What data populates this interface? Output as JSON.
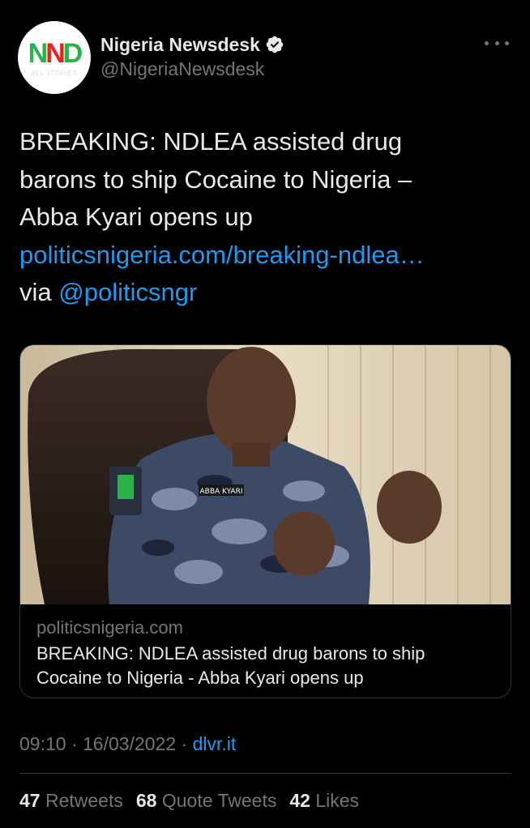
{
  "account": {
    "display_name": "Nigeria Newsdesk",
    "handle": "@NigeriaNewsdesk",
    "avatar_logo": "NND",
    "avatar_sub": "ALL STORIES",
    "verified_icon": "verified-badge-icon"
  },
  "tweet": {
    "line1": "BREAKING: NDLEA assisted drug",
    "line2": "barons to ship Cocaine to Nigeria –",
    "line3": "Abba Kyari opens up",
    "link": "politicsnigeria.com/breaking-ndlea…",
    "via_prefix": "via ",
    "via_handle": "@politicsngr"
  },
  "card": {
    "domain": "politicsnigeria.com",
    "title_line1": "BREAKING: NDLEA assisted drug barons to ship",
    "title_line2": "Cocaine to Nigeria - Abba Kyari opens up",
    "image_badge": "ABBA KYARI"
  },
  "meta": {
    "time": "09:10",
    "sep1": " · ",
    "date": "16/03/2022",
    "sep2": " · ",
    "source": "dlvr.it"
  },
  "stats": {
    "retweets_count": "47",
    "retweets_label": "Retweets",
    "quotes_count": "68",
    "quotes_label": "Quote Tweets",
    "likes_count": "42",
    "likes_label": "Likes"
  },
  "colors": {
    "background": "#000000",
    "text": "#e7e9ea",
    "muted": "#71767b",
    "link": "#1d9bf0",
    "border": "#2f3336"
  }
}
